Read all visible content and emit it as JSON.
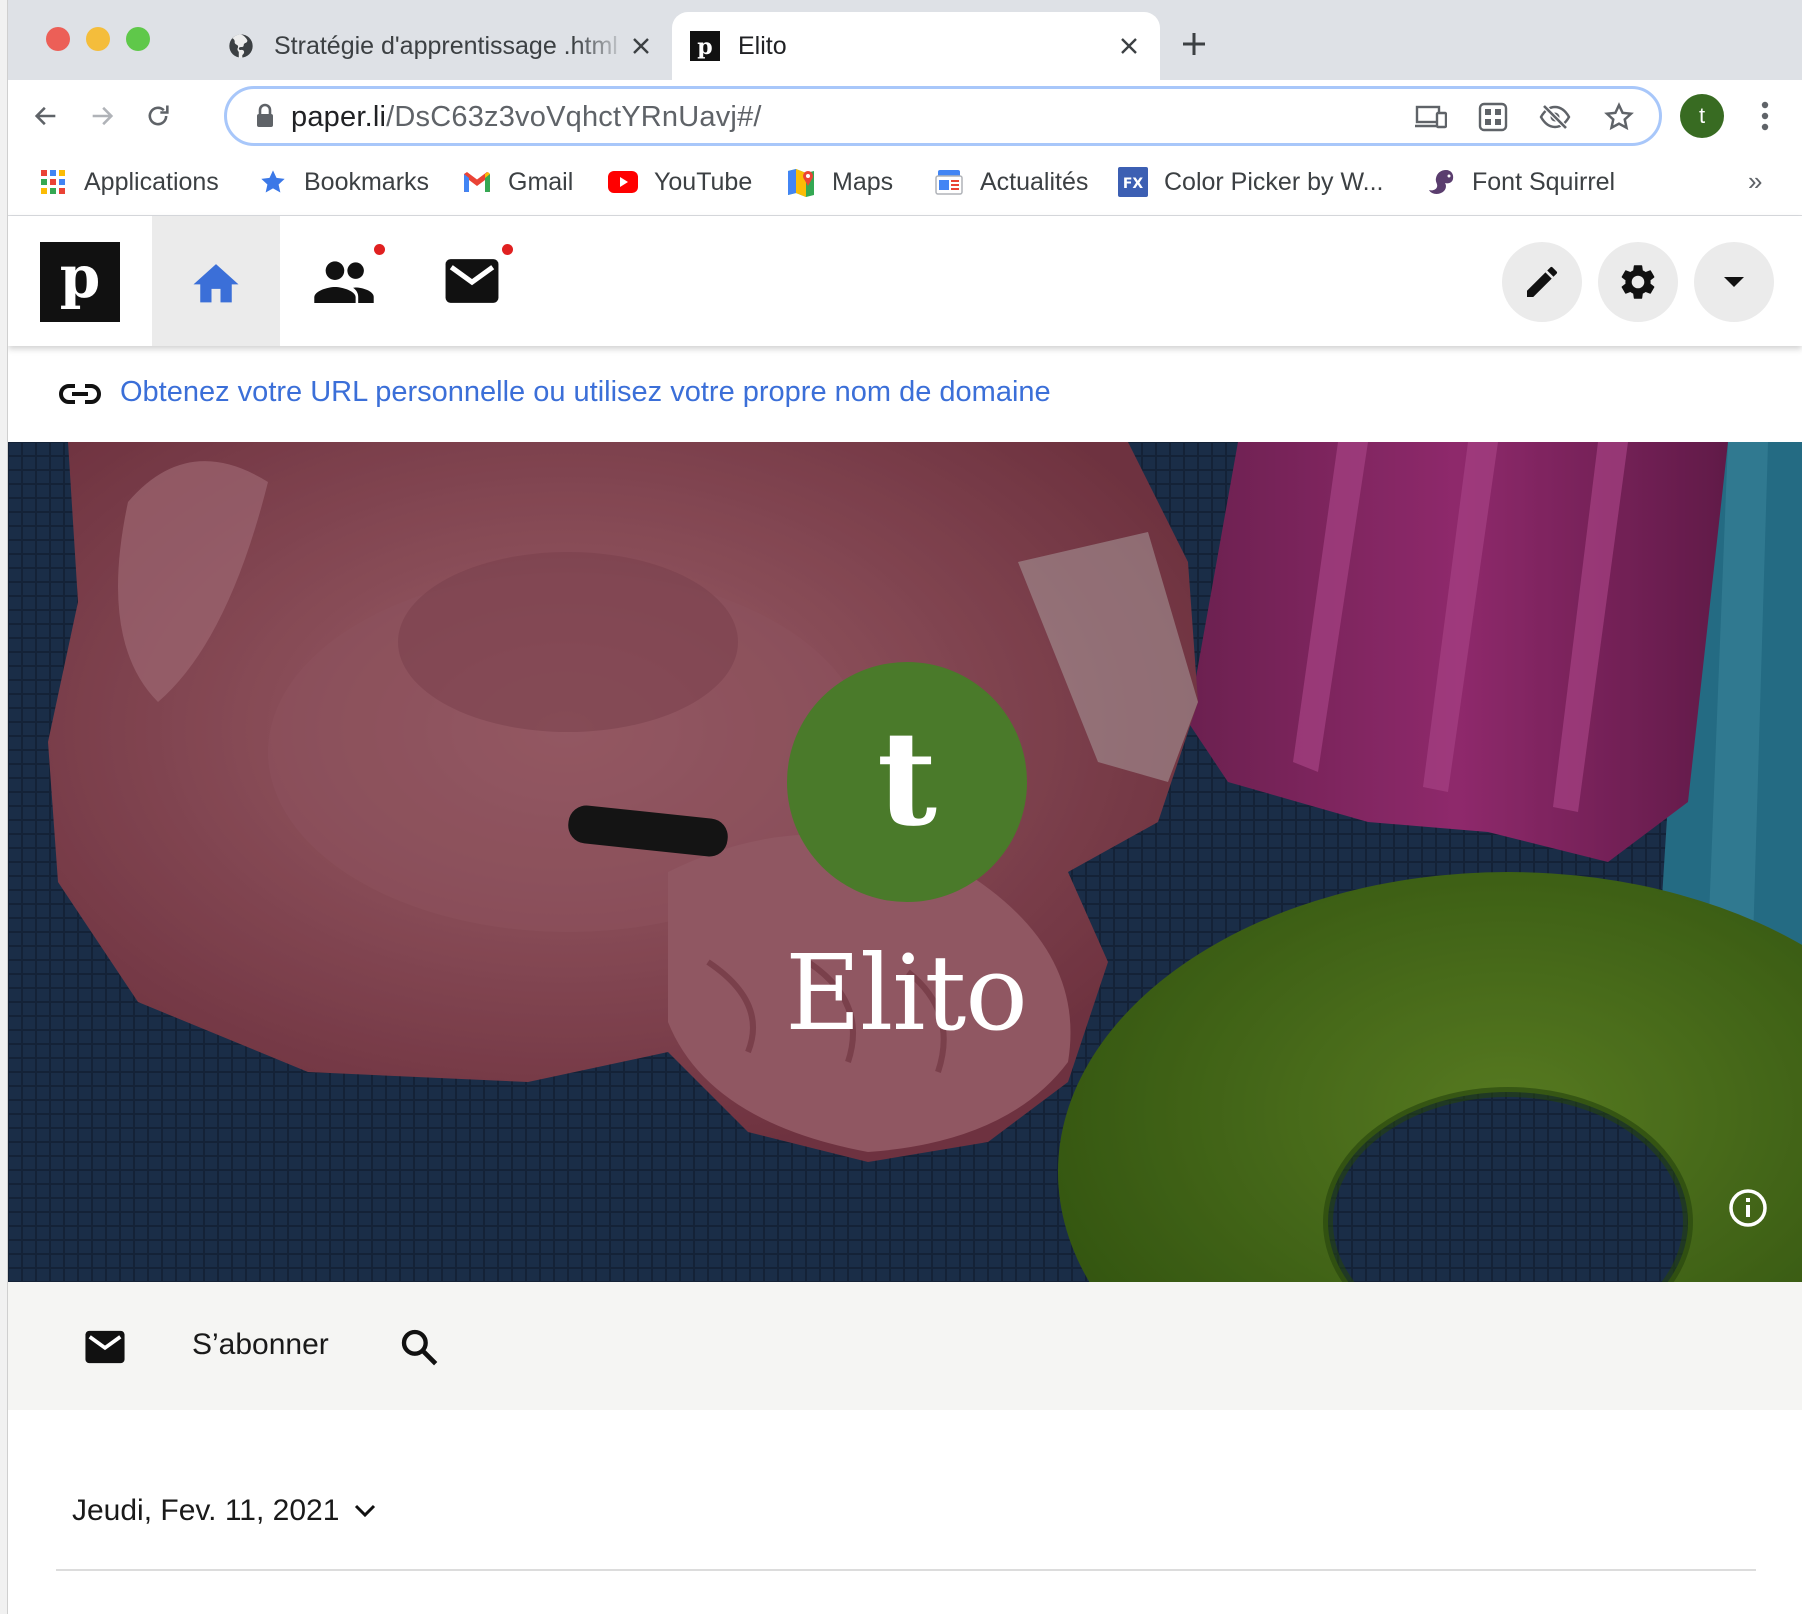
{
  "browser": {
    "tabs": [
      {
        "title": "Stratégie d'apprentissage .html",
        "favicon": "globe-icon",
        "active": false
      },
      {
        "title": "Elito",
        "favicon": "paperli-icon",
        "active": true
      }
    ],
    "url_host": "paper.li",
    "url_path": "/DsC63z3voVqhctYRnUavj#/",
    "profile_initial": "t",
    "colors": {
      "tabstrip": "#dee1e6",
      "omnibox_border": "#a8c7fa",
      "profile": "#386b22"
    }
  },
  "bookmarks": [
    {
      "label": "Applications",
      "icon": "apps-grid-icon"
    },
    {
      "label": "Bookmarks",
      "icon": "star-icon"
    },
    {
      "label": "Gmail",
      "icon": "gmail-icon"
    },
    {
      "label": "YouTube",
      "icon": "youtube-icon"
    },
    {
      "label": "Maps",
      "icon": "maps-icon"
    },
    {
      "label": "Actualités",
      "icon": "news-icon"
    },
    {
      "label": "Color Picker by W...",
      "icon": "colorpicker-icon"
    },
    {
      "label": "Font Squirrel",
      "icon": "squirrel-icon"
    }
  ],
  "bookmarks_more": "»",
  "app": {
    "logo_letter": "p",
    "domain_banner": "Obtenez votre URL personnelle ou utilisez votre propre nom de domaine",
    "accent": "#3b6fd8",
    "notification_color": "#e02020"
  },
  "hero": {
    "avatar_letter": "t",
    "avatar_color": "#4a7a2a",
    "title": "Elito"
  },
  "subscribe": {
    "label": "S’abonner"
  },
  "date": {
    "label": "Jeudi, Fev. 11, 2021"
  }
}
